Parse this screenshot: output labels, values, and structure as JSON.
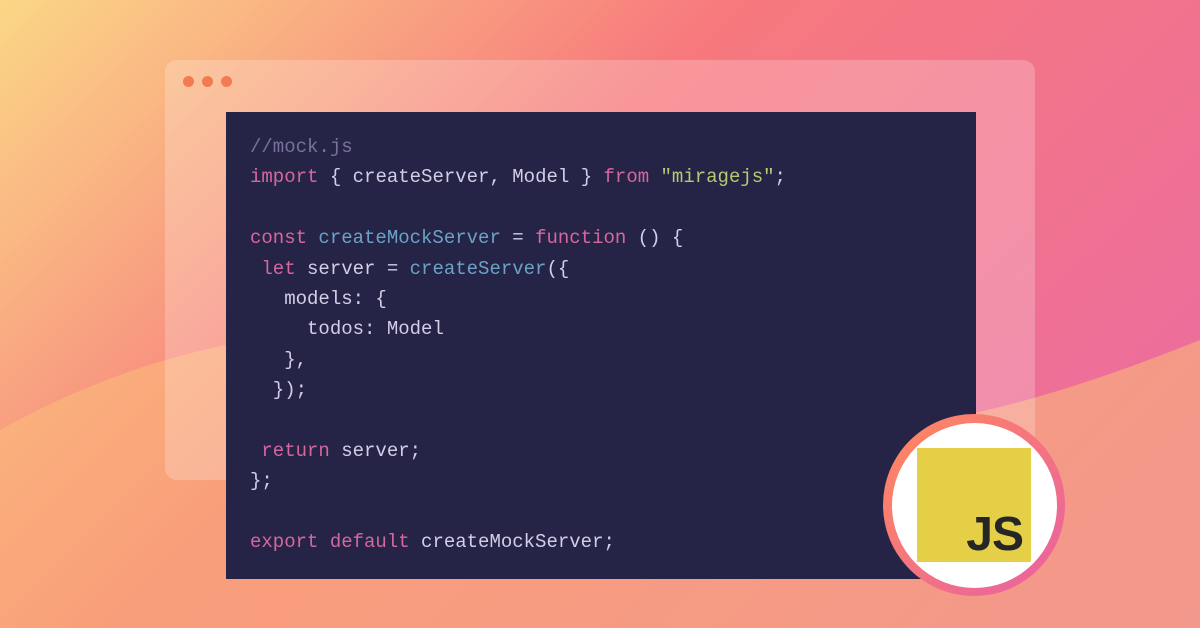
{
  "code": {
    "comment": "//mock.js",
    "kw_import": "import",
    "punc_obrace1": " { ",
    "ident_createServer": "createServer",
    "punc_comma1": ", ",
    "ident_Model": "Model",
    "punc_cbrace1": " } ",
    "kw_from": "from",
    "str_miragejs": " \"miragejs\"",
    "punc_semi1": ";",
    "kw_const": "const",
    "ident_createMockServer": " createMockServer ",
    "punc_eq": "= ",
    "kw_function": "function",
    "punc_fnparen": " () {",
    "kw_let": " let",
    "ident_server": " server ",
    "punc_eq2": "= ",
    "ident_createServer2": "createServer",
    "punc_call_open": "({",
    "prop_models": "   models",
    "punc_colon_brace": ": {",
    "prop_todos": "     todos",
    "punc_colon": ": ",
    "ident_Model2": "Model",
    "punc_cbrace2": "   },",
    "punc_call_close": "  });",
    "kw_return": " return",
    "ident_server2": " server",
    "punc_semi2": ";",
    "punc_fnclose": "};",
    "kw_export": "export",
    "kw_default": " default",
    "ident_createMockServer2": " createMockServer",
    "punc_semi3": ";"
  },
  "badge": {
    "label": "JS"
  }
}
